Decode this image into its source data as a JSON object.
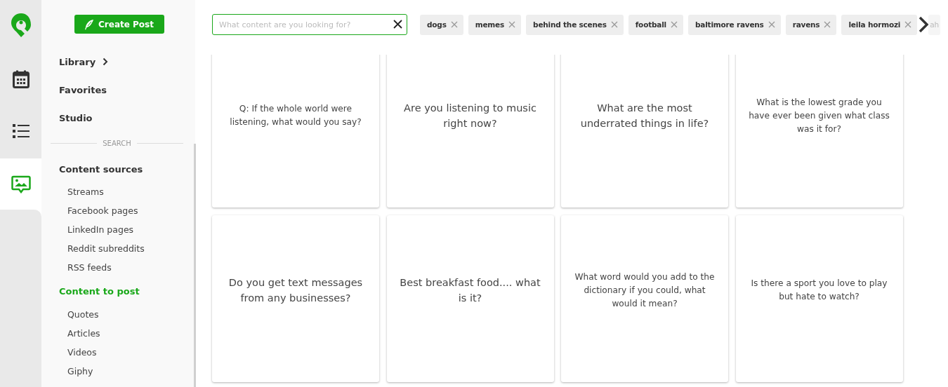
{
  "rail": [
    {
      "kind": "logo",
      "selected": false
    },
    {
      "kind": "calendar",
      "selected": false
    },
    {
      "kind": "list",
      "selected": false
    },
    {
      "kind": "image",
      "selected": true
    }
  ],
  "create_button": {
    "label": "Create Post"
  },
  "nav": [
    {
      "label": "Library",
      "kind": "submenu"
    },
    {
      "label": "Favorites",
      "kind": "plain"
    },
    {
      "label": "Studio",
      "kind": "plain"
    }
  ],
  "divider_label": "SEARCH",
  "groups": [
    {
      "title": "Content sources",
      "selected": false,
      "items": [
        "Streams",
        "Facebook pages",
        "LinkedIn pages",
        "Reddit subreddits",
        "RSS feeds"
      ]
    },
    {
      "title": "Content to post",
      "selected": true,
      "items": [
        "Quotes",
        "Articles",
        "Videos",
        "Giphy"
      ]
    }
  ],
  "search": {
    "placeholder": "What content are you looking for?"
  },
  "tags": [
    {
      "label": "dogs",
      "kind": "full"
    },
    {
      "label": "memes",
      "kind": "full"
    },
    {
      "label": "behind the scenes",
      "kind": "full"
    },
    {
      "label": "football",
      "kind": "full"
    },
    {
      "label": "baltimore ravens",
      "kind": "full"
    },
    {
      "label": "ravens",
      "kind": "full"
    },
    {
      "label": "leila hormozi",
      "kind": "full"
    },
    {
      "label": "ah",
      "kind": "partial"
    }
  ],
  "cards": [
    {
      "text": "Q: If the whole world were listening, what would you say?",
      "kind": "small"
    },
    {
      "text": "Are you listening to music right now?",
      "kind": "large"
    },
    {
      "text": "What are the most underrated things in life?",
      "kind": "large"
    },
    {
      "text": "What is the lowest grade you have ever been given what class was it for?",
      "kind": "small"
    },
    {
      "text": "Do you get text messages from any businesses?",
      "kind": "large"
    },
    {
      "text": "Best breakfast food.... what is it?",
      "kind": "large"
    },
    {
      "text": "What word would you add to the dictionary if you could, what would it mean?",
      "kind": "small"
    },
    {
      "text": "Is there a sport you love to play but hate to watch?",
      "kind": "small"
    }
  ]
}
